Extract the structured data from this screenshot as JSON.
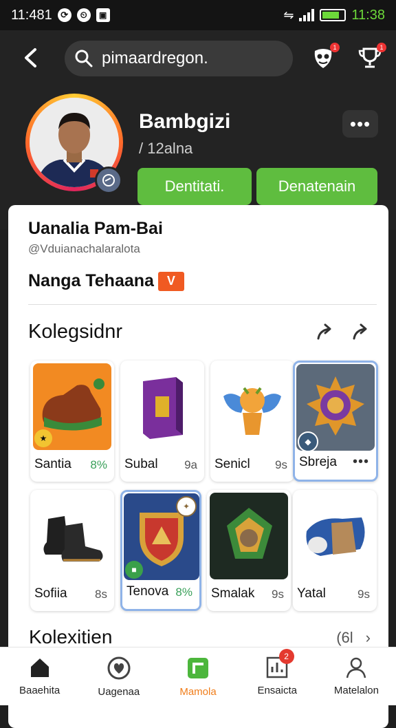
{
  "status": {
    "time_left": "11:481",
    "time_right": "11:38"
  },
  "search": {
    "query": "pimaardregon."
  },
  "header": {
    "notification_count": "1",
    "trophy_count": "1"
  },
  "profile": {
    "name": "Bambgizi",
    "subtitle": "/ 12alna",
    "primary_button": "Dentitati.",
    "secondary_button": "Denatenain",
    "more_label": "•••"
  },
  "about": {
    "display_name": "Uanalia Pam-Bai",
    "handle": "@Vduianachalaralota",
    "tagline": "Nanga Tehaana",
    "tag_badge": "V"
  },
  "collection": {
    "title": "Kolegsidnr",
    "items": [
      {
        "name": "Santia",
        "count": "8%"
      },
      {
        "name": "Subal",
        "count": "9a"
      },
      {
        "name": "Senicl",
        "count": "9s"
      },
      {
        "name": "Sbreja",
        "count": "•••"
      },
      {
        "name": "Sofiia",
        "count": "8s"
      },
      {
        "name": "Tenova",
        "count": "8%"
      },
      {
        "name": "Smalak",
        "count": "9s"
      },
      {
        "name": "Yatal",
        "count": "9s"
      }
    ]
  },
  "collection2": {
    "title": "Kolexitien",
    "right_label": "(6l"
  },
  "nav": {
    "items": [
      {
        "label": "Baaehita"
      },
      {
        "label": "Uagenaa"
      },
      {
        "label": "Mamola"
      },
      {
        "label": "Ensaicta",
        "badge": "2"
      },
      {
        "label": "Matelalon"
      }
    ]
  }
}
